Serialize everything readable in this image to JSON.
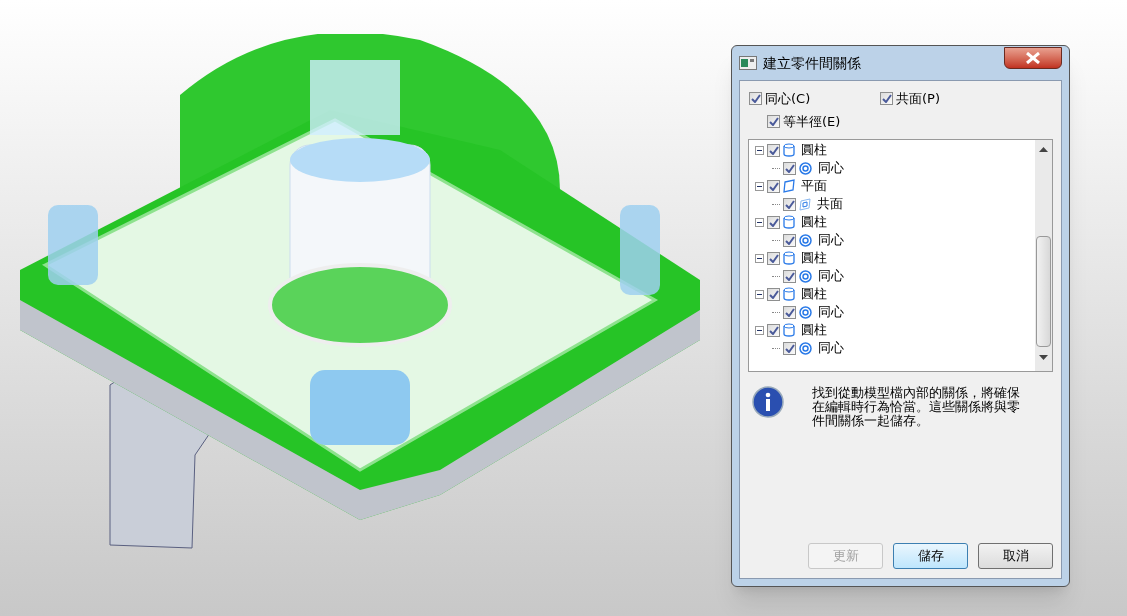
{
  "dialog": {
    "title": "建立零件間關係",
    "options": [
      {
        "label": "同心(C)",
        "checked": true
      },
      {
        "label": "共面(P)",
        "checked": true
      },
      {
        "label": "等半徑(E)",
        "checked": true
      }
    ],
    "tree": [
      {
        "label": "圓柱",
        "kind": "cylinder",
        "checked": true,
        "expanded": true,
        "children": [
          {
            "label": "同心",
            "kind": "concentric",
            "checked": true
          }
        ]
      },
      {
        "label": "平面",
        "kind": "plane",
        "checked": true,
        "expanded": true,
        "children": [
          {
            "label": "共面",
            "kind": "coplanar",
            "checked": true
          }
        ]
      },
      {
        "label": "圓柱",
        "kind": "cylinder",
        "checked": true,
        "expanded": true,
        "children": [
          {
            "label": "同心",
            "kind": "concentric",
            "checked": true
          }
        ]
      },
      {
        "label": "圓柱",
        "kind": "cylinder",
        "checked": true,
        "expanded": true,
        "children": [
          {
            "label": "同心",
            "kind": "concentric",
            "checked": true
          }
        ]
      },
      {
        "label": "圓柱",
        "kind": "cylinder",
        "checked": true,
        "expanded": true,
        "children": [
          {
            "label": "同心",
            "kind": "concentric",
            "checked": true
          }
        ]
      },
      {
        "label": "圓柱",
        "kind": "cylinder",
        "checked": true,
        "expanded": true,
        "children": [
          {
            "label": "同心",
            "kind": "concentric",
            "checked": true
          }
        ]
      }
    ],
    "message": "找到從動模型檔內部的關係，將確保在編輯時行為恰當。這些關係將與零件間關係一起儲存。",
    "buttons": [
      {
        "label": "更新",
        "disabled": true,
        "default": false
      },
      {
        "label": "儲存",
        "disabled": false,
        "default": true
      },
      {
        "label": "取消",
        "disabled": false,
        "default": false
      }
    ]
  }
}
